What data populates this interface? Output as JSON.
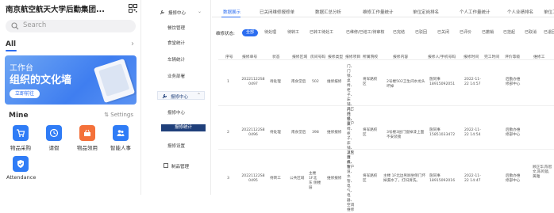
{
  "panel1": {
    "title": "南京航空航天大学后勤集团...",
    "search_placeholder": "Search",
    "section_all": "All",
    "section_arrow": "›",
    "banner": {
      "line1": "工作台",
      "line2": "组织的文化墙",
      "button": "立即前往"
    },
    "mine": {
      "title": "Mine",
      "settings": "Settings",
      "apps": [
        {
          "label": "物品采购",
          "icon": "shopping-cart-icon",
          "color": "#2f7cf6"
        },
        {
          "label": "请假",
          "icon": "clock-icon",
          "color": "#2f7cf6"
        },
        {
          "label": "物品领用",
          "icon": "basket-icon",
          "color": "#f4713a"
        },
        {
          "label": "智能人事",
          "icon": "people-icon",
          "color": "#2f7cf6"
        },
        {
          "label": "Attendance",
          "icon": "attendance-check-icon",
          "color": "#2f7cf6"
        }
      ]
    }
  },
  "panel2": {
    "top_header": "报修中心",
    "items_top": [
      "餐饮管理",
      "食堂统计",
      "车辆统计",
      "业务部署"
    ],
    "active_group": "报修中心",
    "items_sub": [
      "报修中心",
      "报修统计",
      "报修设置"
    ],
    "selected": "报修统计",
    "bottom_item": "制品管理",
    "collapse_arrow": "⌃",
    "expand_arrow": "⌄"
  },
  "panel3": {
    "tabs": [
      "数据展示",
      "已关闭维修报修单",
      "数据汇总分析",
      "维修工作量统计",
      "单位定岗排名",
      "个人工作量统计",
      "个人业绩排名",
      "单位工作量"
    ],
    "active_tab": 0,
    "status_label": "维修状态:",
    "statuses": [
      "全部",
      "待处理",
      "待转工",
      "已转工待处工",
      "已维修/已结工/待审核",
      "已完结",
      "已驳回",
      "已关闭",
      "已评价",
      "已撤销",
      "已挂起",
      "已取消",
      "已退回"
    ],
    "headers": [
      "序号",
      "报修单号",
      "状态",
      "报修区域",
      "房间号码",
      "报修类型",
      "报修项目",
      "所属院校",
      "报修内容",
      "报修人/手机号码",
      "报修时间",
      "完工时间",
      "评价等级",
      "维修工"
    ],
    "rows": [
      {
        "no": "1",
        "code": "20221122S8 0497",
        "status": "待处理",
        "area": "南食堂后",
        "room": "502",
        "type": "维修报修",
        "item": "门、门锁、桌椅、柜子、床铺、其它维修、窗户",
        "school": "将军路校区",
        "content": "2号楼502卫生间水龙头坏掉",
        "reporter": "施同事 18915092051",
        "time": "2022-11-22 14:57",
        "finish": "",
        "rating": "后勤办维修部中心",
        "worker": ""
      },
      {
        "no": "2",
        "code": "20221122S8 0496",
        "status": "待处理",
        "area": "南食堂后",
        "room": "398",
        "type": "维修报修",
        "item": "门、门锁、桌椅、柜子、床铺、其它维修、窗户",
        "school": "将军路校区",
        "content": "3号楼3层门窗掉漆上面不安装锁",
        "reporter": "施同事 15851033472",
        "time": "2022-11-22 14:54",
        "finish": "",
        "rating": "后勤办维修部中心",
        "worker": ""
      },
      {
        "no": "3",
        "code": "20221122S8 0495",
        "status": "待转工",
        "area": "公共区域",
        "room": "主楼 1F北 东 侧楼层",
        "type": "维修报修",
        "item": "卫生洁具、管道、水管、电气、电器、空调维修",
        "school": "将军路校区",
        "content": "主楼 1F北边男厕坐侧门坏掉漏水了，打扫清洗。",
        "reporter": "施同事 18915092016",
        "time": "2022-11-22 14:47",
        "finish": "",
        "rating": "后勤办维修部中心",
        "worker": "顾正华,陈智文,陈鸣镜,黄雅"
      }
    ]
  }
}
